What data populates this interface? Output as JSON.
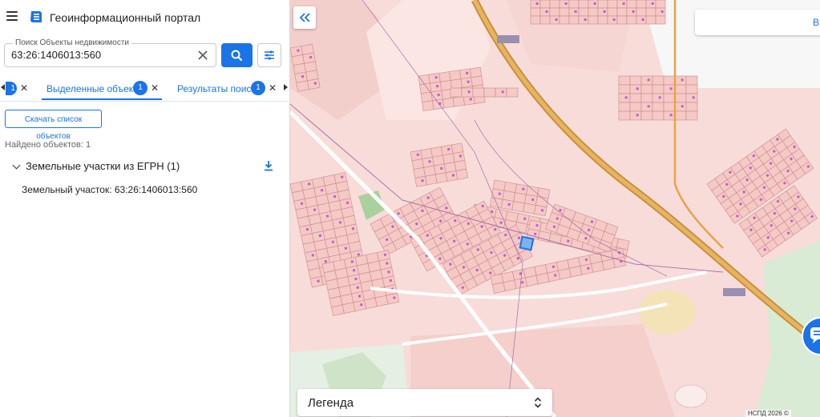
{
  "header": {
    "title": "Геоинформационный портал"
  },
  "search": {
    "label": "Поиск Объекты недвижимости",
    "value": "63:26:1406013:560"
  },
  "tabs": [
    {
      "label": "",
      "badge": "1"
    },
    {
      "label": "Выделенные объекты",
      "badge": "1",
      "active": true
    },
    {
      "label": "Результаты поиска",
      "badge": "1"
    }
  ],
  "results": {
    "download_label": "Скачать список объектов",
    "found_text": "Найдено объектов: 1",
    "group_label": "Земельные участки из ЕГРН (1)",
    "item_label": "Земельный участок: 63:26:1406013:560"
  },
  "map": {
    "layer_button_label": "В",
    "legend_label": "Легенда",
    "attribution": "НСПД 2026 ©",
    "road_label_1": "",
    "road_label_2": "",
    "colors": {
      "accent": "#1b73e8",
      "parcel_fill": "#f5c9c6",
      "parcel_stroke": "#c98a8a",
      "road": "#d7a04a",
      "background": "#f7dcda"
    }
  }
}
